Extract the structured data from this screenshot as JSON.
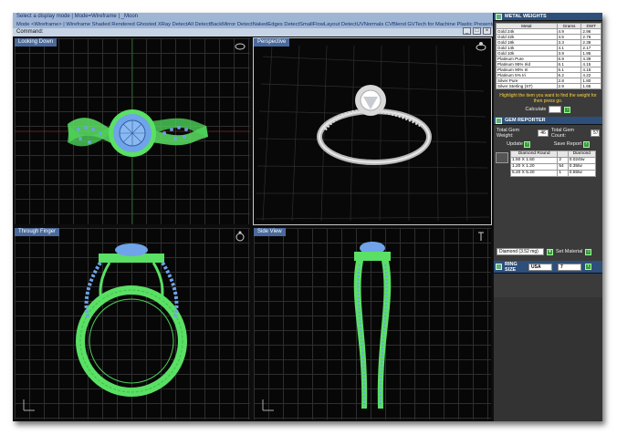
{
  "command_bar": {
    "line1": "Select a display mode | Mode=Wireframe | _Moon",
    "line2": "Mode <Wireframe> | Wireframe  Shaded  Rendered  Ghosted  XRay  DetectAll  DetectBackMirror  DetectNakedEdges  DetectSmallFlowLayout  DetectUVNormals  CVBlend  GVTech for Machine  Plastic  Presentation",
    "line3": "Command:"
  },
  "viewports": {
    "top_left": "Looking Down",
    "top_right": "Perspective",
    "bottom_left": "Through Finger",
    "bottom_right": "Side View"
  },
  "metal_weights": {
    "title": "METAL WEIGHTS",
    "headers": [
      "Metal",
      "Grams",
      "DWT"
    ],
    "rows": [
      [
        "Gold 24k",
        "4.9",
        "2.96"
      ],
      [
        "Gold 22k",
        "4.5",
        "2.76"
      ],
      [
        "Gold 18k",
        "3.3",
        "2.38"
      ],
      [
        "Gold 14k",
        "4.1",
        "2.17"
      ],
      [
        "Gold 10k",
        "3.9",
        "1.95"
      ],
      [
        "Platinum Pure",
        "6.9",
        "4.39"
      ],
      [
        "Platinum 95% Irid",
        "6.1",
        "4.15"
      ],
      [
        "Platinum 90% Iri",
        "6.1",
        "4.15"
      ],
      [
        "Platinum 5% Iri",
        "6.2",
        "4.22"
      ],
      [
        "Silver Pure",
        "2.8",
        "1.80"
      ],
      [
        "Silver Sterling (ST)",
        "2.9",
        "1.65"
      ]
    ],
    "hint": "Highlight the item you want to find the weight for then press go.",
    "calculate_label": "Calculate"
  },
  "gem_reporter": {
    "title": "GEM REPORTER",
    "total_weight_label": "Total Gem Weight:",
    "total_weight_value": "46",
    "total_count_label": "Total Gem Count:",
    "total_count_value": "57",
    "update_label": "Update",
    "save_report_label": "Save Report",
    "headers": [
      "Diamond Round",
      "",
      "Diamond"
    ],
    "rows": [
      [
        "1.50 X 1.50",
        "2",
        "0.024tw"
      ],
      [
        "1.20 X 1.20",
        "54",
        "0.35tw"
      ],
      [
        "5.20 X 5.20",
        "1",
        "0.55tw"
      ]
    ],
    "material_select": "Diamond (3.52 mg)",
    "set_material_label": "Set Material"
  },
  "ring_size": {
    "title": "RING SIZE",
    "region": "USA",
    "size": "7"
  },
  "colors": {
    "wire_green": "#5ae064",
    "wire_blue": "#6fa4e8",
    "title_blue": "#4a6a9c"
  }
}
